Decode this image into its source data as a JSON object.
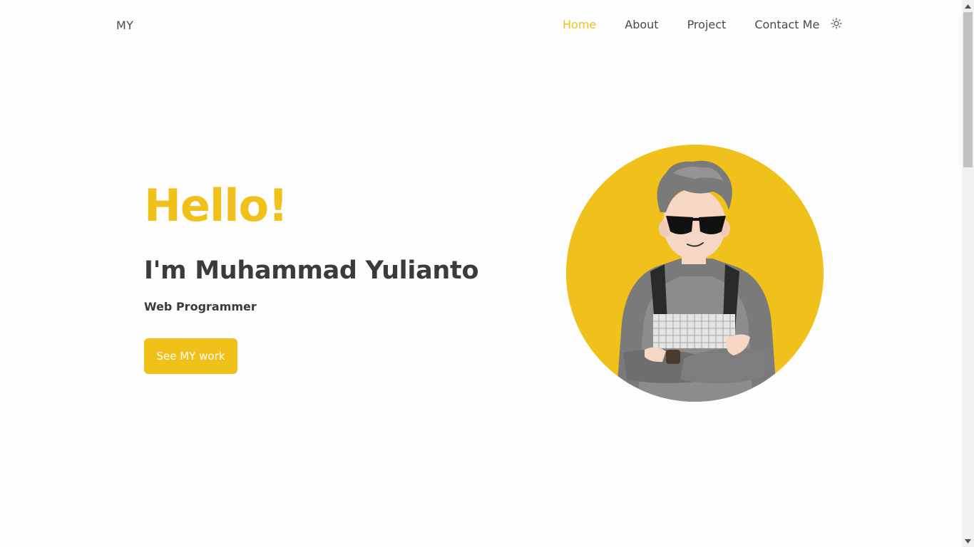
{
  "navbar": {
    "brand": "MY",
    "links": [
      {
        "label": "Home",
        "active": true
      },
      {
        "label": "About",
        "active": false
      },
      {
        "label": "Project",
        "active": false
      },
      {
        "label": "Contact Me",
        "active": false
      }
    ],
    "theme_toggle_icon": "sun-icon"
  },
  "hero": {
    "greeting": "Hello!",
    "name": "I'm Muhammad Yulianto",
    "role": "Web Programmer",
    "cta_label": "See MY work",
    "avatar_icon": "avatar-illustration"
  },
  "colors": {
    "accent": "#f0c11a",
    "text": "#3b3b3b",
    "background": "#fcfdfc"
  }
}
